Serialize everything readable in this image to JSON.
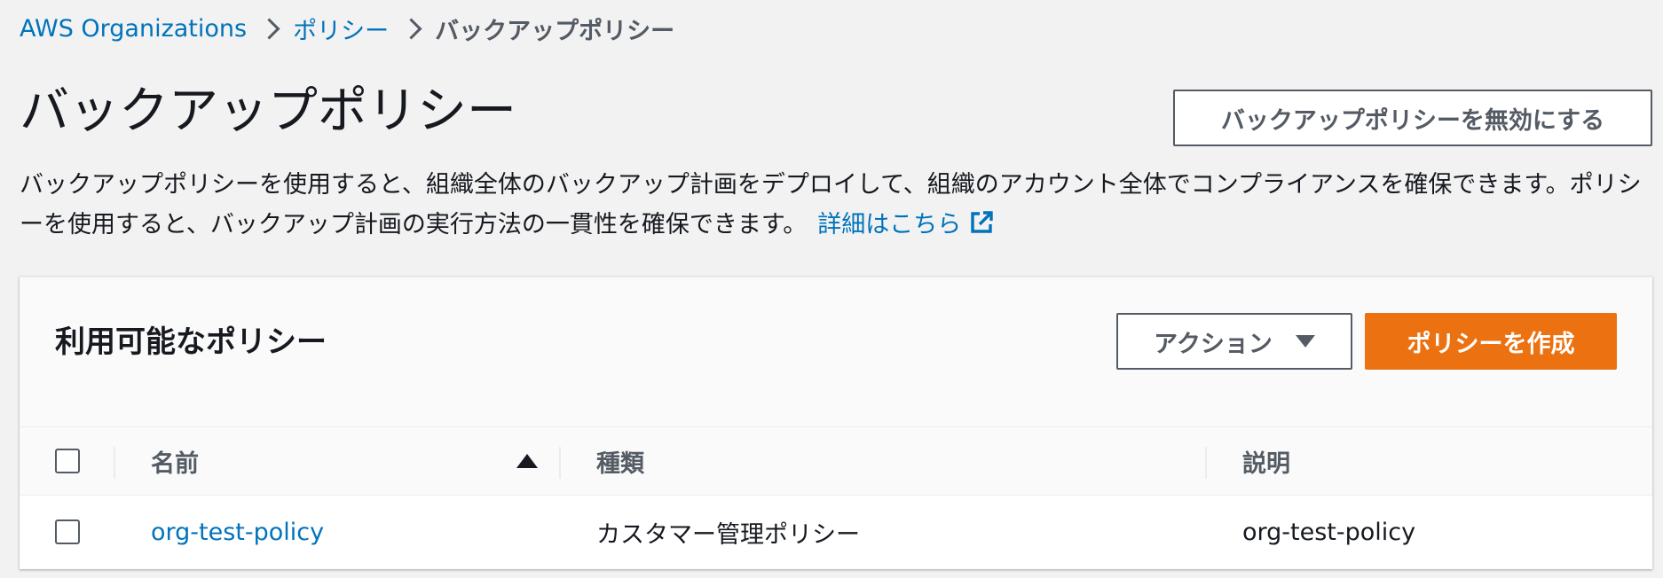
{
  "breadcrumb": {
    "items": [
      "AWS Organizations",
      "ポリシー",
      "バックアップポリシー"
    ]
  },
  "header": {
    "title": "バックアップポリシー",
    "disable_button": "バックアップポリシーを無効にする"
  },
  "description": {
    "text": "バックアップポリシーを使用すると、組織全体のバックアップ計画をデプロイして、組織のアカウント全体でコンプライアンスを確保できます。ポリシーを使用すると、バックアップ計画の実行方法の一貫性を確保できます。",
    "learn_more": "詳細はこちら",
    "learn_more_icon": "external-link-icon"
  },
  "policies_panel": {
    "title": "利用可能なポリシー",
    "actions_button": "アクション",
    "create_button": "ポリシーを作成",
    "columns": [
      "名前",
      "種類",
      "説明"
    ],
    "sort": {
      "column": "名前",
      "direction": "ascending"
    },
    "rows": [
      {
        "name": "org-test-policy",
        "type": "カスタマー管理ポリシー",
        "description": "org-test-policy"
      }
    ]
  },
  "colors": {
    "link": "#0073bb",
    "primary": "#ec7211",
    "text": "#16191f",
    "secondary_text": "#545b64",
    "background": "#f2f2f2"
  }
}
